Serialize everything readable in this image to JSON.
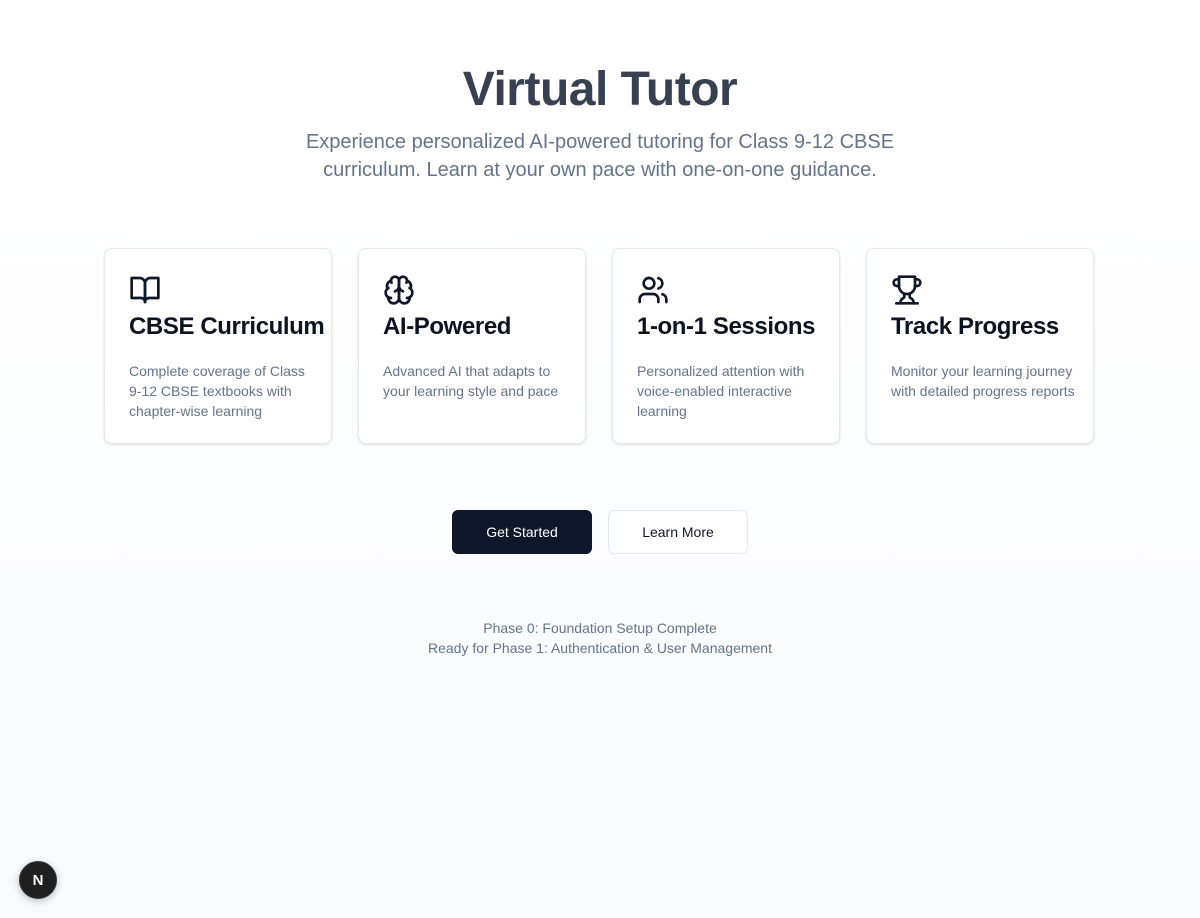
{
  "hero": {
    "title": "Virtual Tutor",
    "subtitle": "Experience personalized AI-powered tutoring for Class 9-12 CBSE curriculum. Learn at your own pace with one-on-one guidance."
  },
  "features": [
    {
      "icon": "book-open-icon",
      "title": "CBSE Curriculum",
      "description": "Complete coverage of Class 9-12 CBSE textbooks with chapter-wise learning"
    },
    {
      "icon": "brain-icon",
      "title": "AI-Powered",
      "description": "Advanced AI that adapts to your learning style and pace"
    },
    {
      "icon": "users-icon",
      "title": "1-on-1 Sessions",
      "description": "Personalized attention with voice-enabled interactive learning"
    },
    {
      "icon": "trophy-icon",
      "title": "Track Progress",
      "description": "Monitor your learning journey with detailed progress reports"
    }
  ],
  "actions": {
    "primary_label": "Get Started",
    "secondary_label": "Learn More"
  },
  "status": {
    "line1": "Phase 0: Foundation Setup Complete",
    "line2": "Ready for Phase 1: Authentication & User Management"
  },
  "dev_badge": {
    "label": "N",
    "icon": "nextjs-logo-icon"
  },
  "colors": {
    "primary": "#0f172a",
    "muted_text": "#64748b",
    "title_text": "#374151",
    "card_border": "#e2e8f0"
  }
}
